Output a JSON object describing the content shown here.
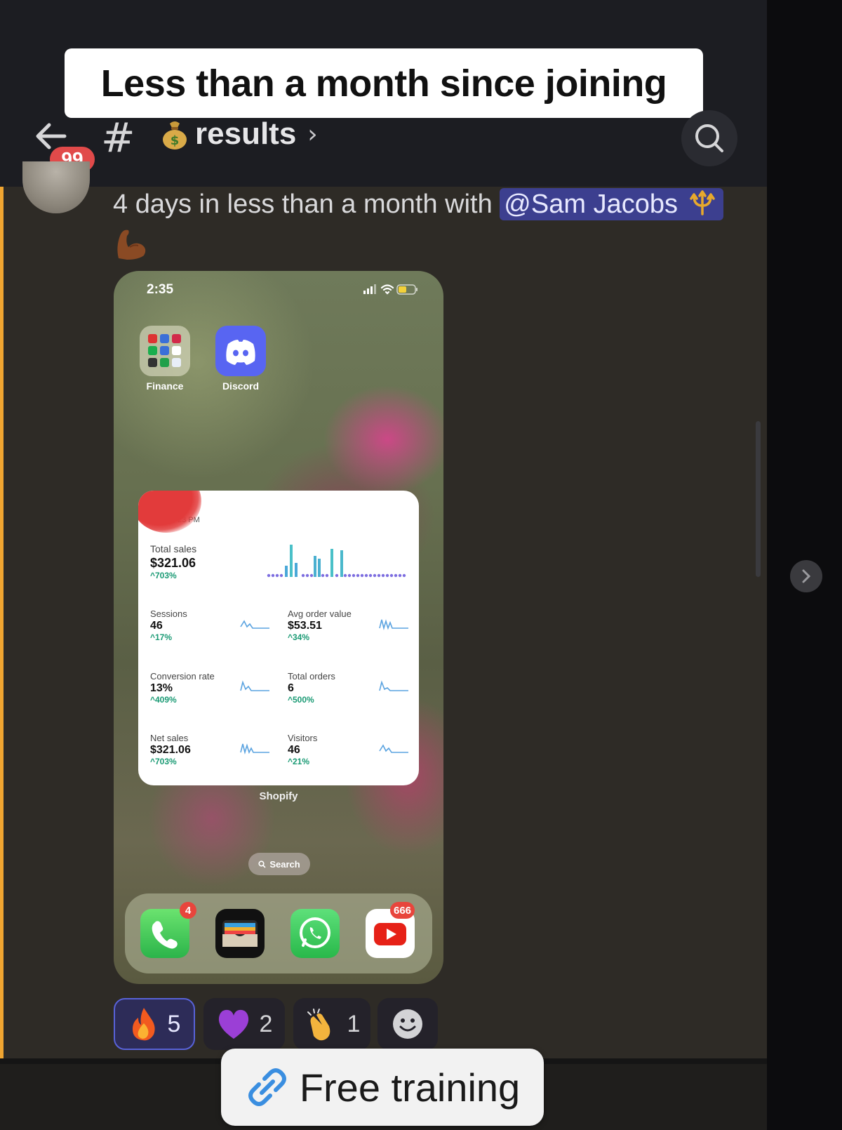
{
  "overlay_caption": "Less than a month since joining",
  "header": {
    "unread_badge": "99",
    "hash": "#",
    "channel_name": "results",
    "channel_chevron": "›",
    "channel_emoji_icon": "money-bag-icon",
    "search_icon": "search-icon"
  },
  "message": {
    "text_prefix": "4 days in less than a month with ",
    "mention": "@Sam Jacobs",
    "mention_emoji_icon": "trident-icon",
    "trailing_emoji_icon": "flexed-biceps-icon"
  },
  "phone_screenshot": {
    "time": "2:35",
    "apps": [
      {
        "label": "Finance",
        "icon": "finance-folder-icon"
      },
      {
        "label": "Discord",
        "icon": "discord-icon"
      }
    ],
    "widget": {
      "time": "23 PM",
      "total_sales_label": "Total sales",
      "total_sales_value": "$321.06",
      "total_sales_pct": "^703%",
      "metrics": [
        {
          "label": "Sessions",
          "value": "46",
          "pct": "^17%"
        },
        {
          "label": "Avg order value",
          "value": "$53.51",
          "pct": "^34%"
        },
        {
          "label": "Conversion rate",
          "value": "13%",
          "pct": "^409%"
        },
        {
          "label": "Total orders",
          "value": "6",
          "pct": "^500%"
        },
        {
          "label": "Net sales",
          "value": "$321.06",
          "pct": "^703%"
        },
        {
          "label": "Visitors",
          "value": "46",
          "pct": "^21%"
        }
      ],
      "app_label": "Shopify"
    },
    "search_pill": "Search",
    "dock": [
      {
        "icon": "phone-icon",
        "badge": "4"
      },
      {
        "icon": "wallet-icon",
        "badge": ""
      },
      {
        "icon": "whatsapp-icon",
        "badge": ""
      },
      {
        "icon": "youtube-icon",
        "badge": "666"
      }
    ]
  },
  "reactions": [
    {
      "emoji": "fire-icon",
      "count": "5",
      "active": true
    },
    {
      "emoji": "purple-heart-icon",
      "count": "2",
      "active": false
    },
    {
      "emoji": "clapping-hands-icon",
      "count": "1",
      "active": false
    },
    {
      "emoji": "add-reaction-icon",
      "count": "",
      "active": false
    }
  ],
  "cta": {
    "label": "Free training",
    "icon": "link-icon"
  },
  "colors": {
    "mention_bg": "#3c3f8f",
    "active_reaction_border": "#5862d8",
    "unread_badge": "#e14a4a",
    "message_stripe": "#f0a531"
  }
}
